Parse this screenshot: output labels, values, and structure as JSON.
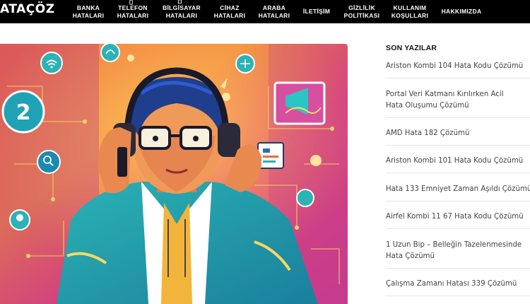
{
  "header": {
    "logo_text": "ATAÇÖZ",
    "nav": [
      {
        "label": "BANKA\nHATALARI"
      },
      {
        "label": "TELEFON\nHATALARI"
      },
      {
        "label": "BİLGİSAYAR\nHATALARI"
      },
      {
        "label": "CİHAZ\nHATALARI"
      },
      {
        "label": "ARABA\nHATALARI"
      },
      {
        "label": "İLETİŞİM"
      },
      {
        "label": "GİZLİLİK\nPOLİTİKASI"
      },
      {
        "label": "KULLANIM\nKOŞULLARI"
      },
      {
        "label": "HAKKIMIZDA"
      }
    ],
    "icons": {
      "phone": "phone-icon",
      "laptop": "laptop-icon"
    }
  },
  "hero": {
    "badge_number": "2",
    "icon_names": [
      "wifi-icon",
      "headset-icon",
      "audio-wave-icon",
      "window-icon",
      "search-icon",
      "lightbulb-icon"
    ]
  },
  "sidebar": {
    "title": "SON YAZILAR",
    "posts": [
      {
        "title": "Ariston Kombi 104 Hata Kodu Çözümü"
      },
      {
        "title": "Portal Veri Katmanı Kırılırken Acil Hata Oluşumu Çözümü"
      },
      {
        "title": "AMD Hata 182 Çözümü"
      },
      {
        "title": "Ariston Kombi 101 Hata Kodu Çözümü"
      },
      {
        "title": "Hata 133 Emniyet Zaman Aşıldı Çözümü"
      },
      {
        "title": "Airfel Kombi 11 67 Hata Kodu Çözümü"
      },
      {
        "title": "1 Uzun Bip – Belleğin Tazelenmesinde Hata Çözümü"
      },
      {
        "title": "Çalışma Zamanı Hatası 339 Çözümü"
      }
    ]
  },
  "colors": {
    "nav_bg": "#000000",
    "nav_text": "#ffffff",
    "sidebar_text": "#444444",
    "divider": "#e6e6e6"
  }
}
